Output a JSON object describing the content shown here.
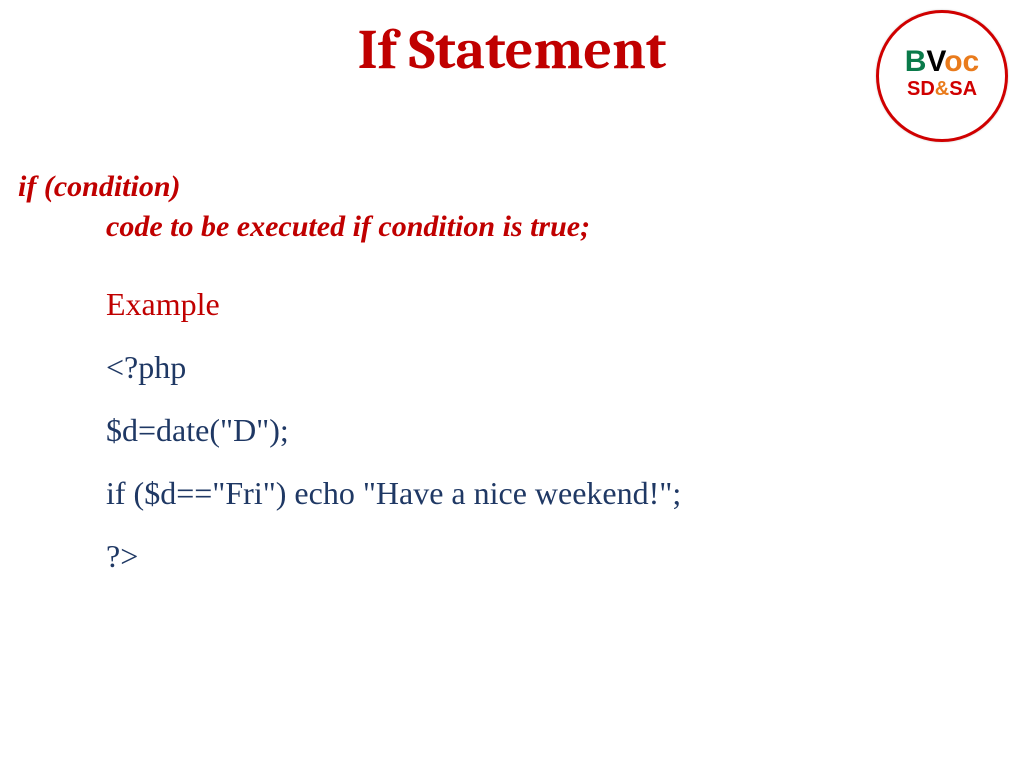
{
  "title": "If Statement",
  "logo": {
    "top_b": "B",
    "top_v": "V",
    "top_oc": "oc",
    "sub_sd": "SD",
    "sub_amp": "&",
    "sub_sa": "SA"
  },
  "syntax": {
    "line1": "if (condition)",
    "line2": "code to be executed if condition is true;"
  },
  "example": {
    "heading": "Example",
    "lines": [
      "<?php",
      "$d=date(\"D\");",
      "if ($d==\"Fri\") echo \"Have a nice weekend!\";",
      "?>"
    ]
  }
}
